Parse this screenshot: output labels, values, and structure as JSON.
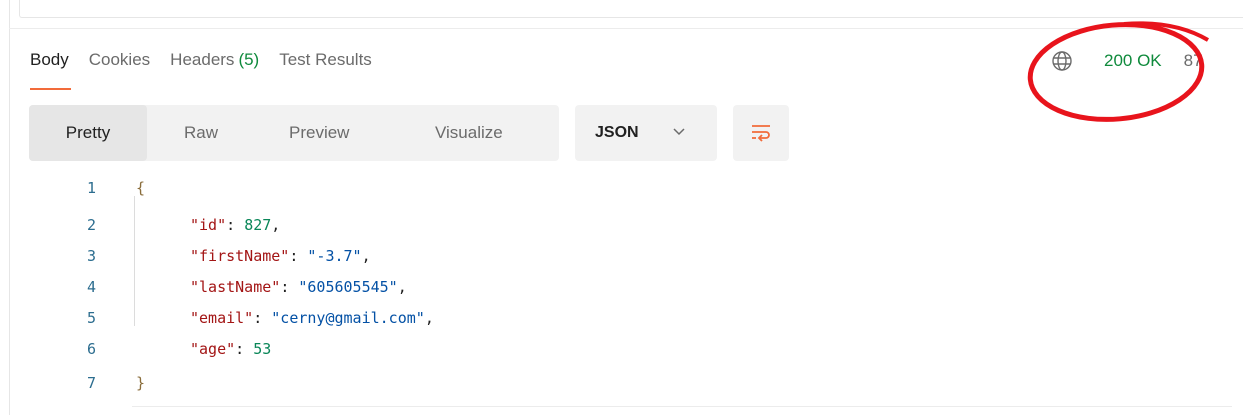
{
  "tabs": [
    {
      "label": "Body",
      "active": true
    },
    {
      "label": "Cookies"
    },
    {
      "label": "Headers",
      "count": "(5)"
    },
    {
      "label": "Test Results"
    }
  ],
  "status": {
    "code_text": "200 OK",
    "size_text": "87",
    "code_color": "#0f8a3c"
  },
  "view_modes": [
    "Pretty",
    "Raw",
    "Preview",
    "Visualize"
  ],
  "active_view": "Pretty",
  "format": {
    "label": "JSON"
  },
  "accent_color": "#f26b3a",
  "response": {
    "line_numbers": [
      "1",
      "2",
      "3",
      "4",
      "5",
      "6",
      "7"
    ],
    "open_brace": "{",
    "close_brace": "}",
    "fields": [
      {
        "key": "\"id\"",
        "value": "827",
        "type": "number",
        "comma": ","
      },
      {
        "key": "\"firstName\"",
        "value": "\"-3.7\"",
        "type": "string",
        "comma": ","
      },
      {
        "key": "\"lastName\"",
        "value": "\"605605545\"",
        "type": "string",
        "comma": ","
      },
      {
        "key": "\"email\"",
        "value": "\"cerny@gmail.com\"",
        "type": "string",
        "comma": ","
      },
      {
        "key": "\"age\"",
        "value": "53",
        "type": "number",
        "comma": ""
      }
    ]
  }
}
